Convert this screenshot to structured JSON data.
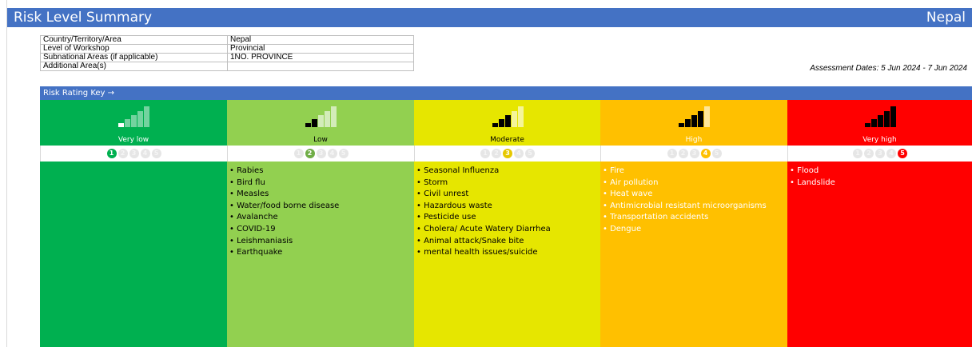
{
  "header": {
    "title": "Risk Level Summary",
    "country": "Nepal"
  },
  "info_table": [
    {
      "label": "Country/Territory/Area",
      "value": "Nepal"
    },
    {
      "label": "Level of Workshop",
      "value": "Provincial"
    },
    {
      "label": "Subnational Areas (if applicable)",
      "value": "1NO. PROVINCE"
    },
    {
      "label": "Additional Area(s)",
      "value": ""
    }
  ],
  "assessment_dates": "Assessment Dates:   5 Jun 2024  -  7 Jun 2024",
  "risk_key_label": "Risk Rating Key →",
  "levels": [
    {
      "label": "Very low",
      "number": "1",
      "bg": "#00b050",
      "text_color": "#ffffff",
      "dot_color": "#00b050",
      "items": []
    },
    {
      "label": "Low",
      "number": "2",
      "bg": "#92d050",
      "text_color": "#000000",
      "dot_color": "#70ad47",
      "items": [
        "• Rabies",
        "• Bird flu",
        "• Measles",
        "• Water/food borne disease",
        "• Avalanche",
        "• COVID-19",
        "• Leishmaniasis",
        "• Earthquake"
      ]
    },
    {
      "label": "Moderate",
      "number": "3",
      "bg": "#e6e600",
      "text_color": "#000000",
      "dot_color": "#e6c800",
      "items": [
        "• Seasonal Influenza",
        "• Storm",
        "• Civil unrest",
        "• Hazardous waste",
        "• Pesticide use",
        "• Cholera/ Acute Watery Diarrhea",
        "• Animal attack/Snake bite",
        "• mental health issues/suicide"
      ]
    },
    {
      "label": "High",
      "number": "4",
      "bg": "#ffc000",
      "text_color": "#ffffff",
      "dot_color": "#ffc000",
      "items": [
        "• Fire",
        "• Air pollution",
        "• Heat wave",
        "• Antimicrobial resistant microorganisms",
        "• Transportation accidents",
        "• Dengue"
      ]
    },
    {
      "label": "Very high",
      "number": "5",
      "bg": "#ff0000",
      "text_color": "#ffffff",
      "dot_color": "#ff0000",
      "items": [
        "• Flood",
        "• Landslide"
      ]
    }
  ]
}
